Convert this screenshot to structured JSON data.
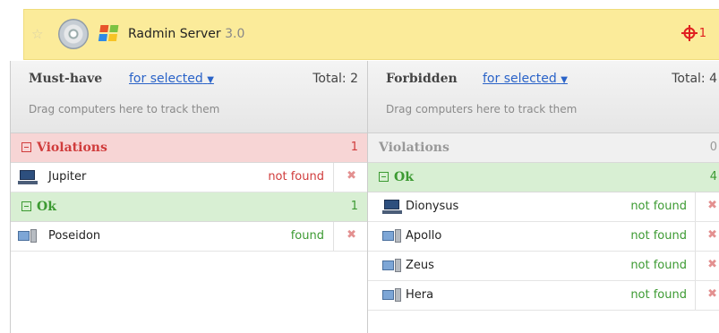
{
  "app": {
    "title": "Radmin Server",
    "version": "3.0",
    "alerts": "1"
  },
  "colors": {
    "red": "#d03c3c",
    "green": "#3c9a32",
    "link": "#2a63c8"
  },
  "panels": {
    "must_have": {
      "title": "Must-have",
      "link": "for selected",
      "total": "Total: 2",
      "hint": "Drag computers here to track them",
      "groups": {
        "violations": {
          "label": "Violations",
          "count": "1",
          "rows": [
            {
              "name": "Jupiter",
              "status": "not found",
              "icon": "laptop-icon"
            }
          ]
        },
        "ok": {
          "label": "Ok",
          "count": "1",
          "rows": [
            {
              "name": "Poseidon",
              "status": "found",
              "icon": "desktop-icon"
            }
          ]
        }
      }
    },
    "forbidden": {
      "title": "Forbidden",
      "link": "for selected",
      "total": "Total: 4",
      "hint": "Drag computers here to track them",
      "groups": {
        "violations": {
          "label": "Violations",
          "count": "0"
        },
        "ok": {
          "label": "Ok",
          "count": "4",
          "rows": [
            {
              "name": "Dionysus",
              "status": "not found",
              "icon": "laptop-icon"
            },
            {
              "name": "Apollo",
              "status": "not found",
              "icon": "desktop-icon"
            },
            {
              "name": "Zeus",
              "status": "not found",
              "icon": "desktop-icon"
            },
            {
              "name": "Hera",
              "status": "not found",
              "icon": "desktop-icon"
            }
          ]
        }
      }
    }
  }
}
